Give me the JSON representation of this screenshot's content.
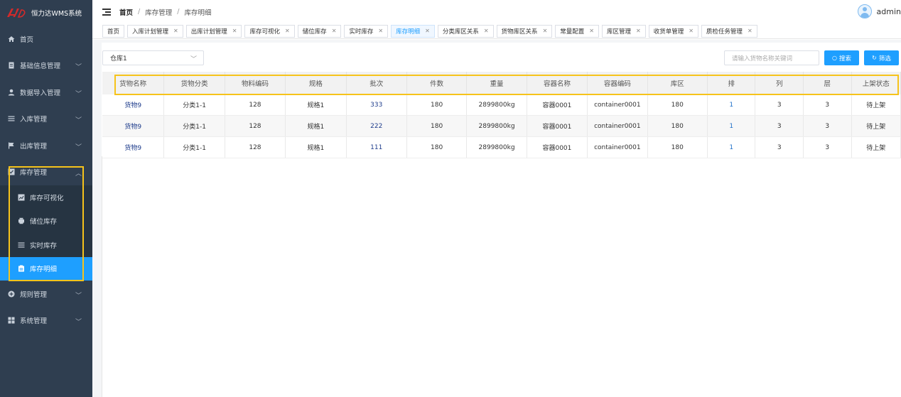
{
  "app": {
    "title": "恒力达WMS系统"
  },
  "sidebar": {
    "items": [
      {
        "label": "首页",
        "icon": "home-icon"
      },
      {
        "label": "基础信息管理",
        "icon": "document-icon"
      },
      {
        "label": "数据导入管理",
        "icon": "user-icon"
      },
      {
        "label": "入库管理",
        "icon": "list-icon"
      },
      {
        "label": "出库管理",
        "icon": "flag-icon"
      },
      {
        "label": "库存管理",
        "icon": "checkbox-icon"
      },
      {
        "label": "规则管理",
        "icon": "plus-circle-icon"
      },
      {
        "label": "系统管理",
        "icon": "grid-icon"
      }
    ],
    "inventory_sub": [
      {
        "label": "库存可视化",
        "icon": "chart-icon"
      },
      {
        "label": "储位库存",
        "icon": "print-icon"
      },
      {
        "label": "实时库存",
        "icon": "list-icon"
      },
      {
        "label": "库存明细",
        "icon": "clipboard-icon"
      }
    ]
  },
  "header": {
    "breadcrumb": [
      "首页",
      "库存管理",
      "库存明细"
    ],
    "user": "admin"
  },
  "tabs": [
    {
      "label": "首页",
      "closable": false
    },
    {
      "label": "入库计划管理",
      "closable": true
    },
    {
      "label": "出库计划管理",
      "closable": true
    },
    {
      "label": "库存可视化",
      "closable": true
    },
    {
      "label": "储位库存",
      "closable": true
    },
    {
      "label": "实时库存",
      "closable": true
    },
    {
      "label": "库存明细",
      "closable": true,
      "active": true
    },
    {
      "label": "分类库区关系",
      "closable": true
    },
    {
      "label": "货物库区关系",
      "closable": true
    },
    {
      "label": "常量配置",
      "closable": true
    },
    {
      "label": "库区管理",
      "closable": true
    },
    {
      "label": "收货单管理",
      "closable": true
    },
    {
      "label": "质检任务管理",
      "closable": true
    }
  ],
  "filters": {
    "warehouse_value": "仓库1",
    "search_placeholder": "请输入货物名称关键词",
    "search_label": "搜索",
    "filter_label": "筛选"
  },
  "table": {
    "columns": [
      "货物名称",
      "货物分类",
      "物料编码",
      "规格",
      "批次",
      "件数",
      "重量",
      "容器名称",
      "容器编码",
      "库区",
      "排",
      "列",
      "层",
      "上架状态"
    ],
    "rows": [
      [
        "货物9",
        "分类1-1",
        "128",
        "规格1",
        "333",
        "180",
        "2899800kg",
        "容器0001",
        "container0001",
        "180",
        "1",
        "3",
        "3",
        "待上架"
      ],
      [
        "货物9",
        "分类1-1",
        "128",
        "规格1",
        "222",
        "180",
        "2899800kg",
        "容器0001",
        "container0001",
        "180",
        "1",
        "3",
        "3",
        "待上架"
      ],
      [
        "货物9",
        "分类1-1",
        "128",
        "规格1",
        "111",
        "180",
        "2899800kg",
        "容器0001",
        "container0001",
        "180",
        "1",
        "3",
        "3",
        "待上架"
      ]
    ]
  },
  "colors": {
    "sidebar": "#2f3e50",
    "accent": "#1e9fff",
    "highlight": "#f6c31b"
  }
}
